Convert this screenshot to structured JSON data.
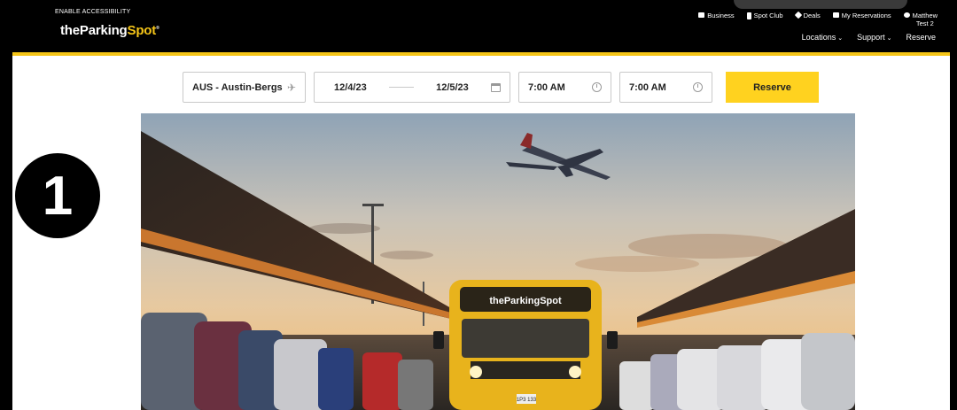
{
  "header": {
    "accessibility_label": "ENABLE ACCESSIBILITY",
    "logo": {
      "part1": "theParking",
      "part2": "Spot",
      "mark": "®"
    },
    "top_nav": [
      {
        "label": "Business",
        "icon": "briefcase-icon"
      },
      {
        "label": "Spot Club",
        "icon": "card-icon"
      },
      {
        "label": "Deals",
        "icon": "tag-icon"
      },
      {
        "label": "My Reservations",
        "icon": "calendar-icon"
      }
    ],
    "user": {
      "line1": "Matthew",
      "line2": "Test 2",
      "icon": "user-icon"
    },
    "sub_nav": [
      {
        "label": "Locations"
      },
      {
        "label": "Support"
      },
      {
        "label": "Reserve"
      }
    ]
  },
  "search": {
    "airport": "AUS - Austin-Bergs",
    "airport_icon": "airplane-icon",
    "start_date": "12/4/23",
    "end_date": "12/5/23",
    "date_icon": "calendar-icon",
    "start_time": "7:00 AM",
    "end_time": "7:00 AM",
    "time_icon": "clock-icon",
    "reserve_label": "Reserve"
  },
  "annotation": {
    "step_number": "1"
  },
  "hero": {
    "shuttle_sign": "theParkingSpot",
    "plate": "1P3 133"
  },
  "colors": {
    "brand_yellow": "#ffd21f",
    "header_bg": "#000000"
  }
}
